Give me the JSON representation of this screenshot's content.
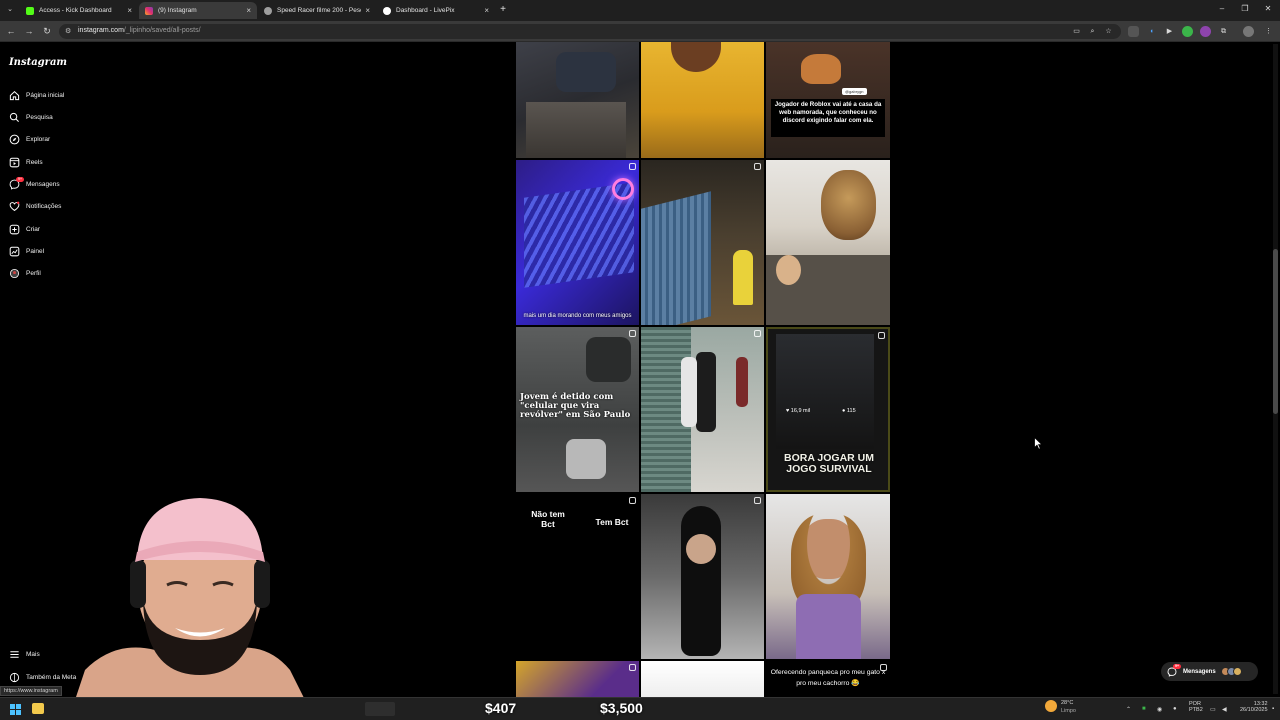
{
  "browser": {
    "tabs": [
      {
        "title": "Access - Kick Dashboard",
        "color": "#53fc18",
        "active": false
      },
      {
        "title": "(9) Instagram",
        "color": "#e1306c",
        "active": true
      },
      {
        "title": "Speed Racer filme 200 - Pesqui",
        "color": "#9e9e9e",
        "active": false
      },
      {
        "title": "Dashboard - LivePix",
        "color": "#ffffff",
        "active": false
      }
    ],
    "url_host": "instagram.com",
    "url_path": "/_lipinho/saved/all-posts/",
    "new_tab": "+",
    "status_url": "https://www.instagram"
  },
  "instagram": {
    "logo": "Instagram",
    "nav": [
      {
        "label": "Página inicial",
        "icon": "home-icon"
      },
      {
        "label": "Pesquisa",
        "icon": "search-icon"
      },
      {
        "label": "Explorar",
        "icon": "compass-icon"
      },
      {
        "label": "Reels",
        "icon": "reels-icon"
      },
      {
        "label": "Mensagens",
        "icon": "messenger-icon"
      },
      {
        "label": "Notificações",
        "icon": "heart-icon"
      },
      {
        "label": "Criar",
        "icon": "plus-square-icon"
      },
      {
        "label": "Painel",
        "icon": "dashboard-icon"
      },
      {
        "label": "Perfil",
        "icon": "avatar-icon"
      }
    ],
    "nav_more": "Mais",
    "nav_meta": "Também da Meta",
    "messages_badge": "9+",
    "messages_pill": "Mensagens",
    "posts": {
      "roblox": "Jogador de Roblox vai até a casa da web namorada, que conheceu no discord exigindo falar com ela.",
      "roblox_tag": "@gabrygn",
      "amigos": "mais um dia morando com meus amigos",
      "jovem": "Jovem é detido com \"celular que vira revólver\" em São Paulo",
      "likes": "16,9 mil",
      "comments": "115",
      "bora": "BORA JOGAR UM JOGO SURVIVAL",
      "nao_tem": "Não tem Bct",
      "tem": "Tem Bct",
      "panqueca": "Oferecendo panqueca pro meu gato x pro meu cachorro 😂"
    }
  },
  "stream": {
    "donation_1": "$407",
    "donation_2": "$3,500"
  },
  "taskbar": {
    "weather_temp": "28°C",
    "weather_desc": "Limpo",
    "lang_1": "POR",
    "lang_2": "PTB2",
    "time": "13:32",
    "date": "26/10/2025"
  },
  "colors": {
    "instagram_bg": "#000000",
    "chrome_tab_active": "#3a3a3a",
    "notification_red": "#ff3040"
  }
}
